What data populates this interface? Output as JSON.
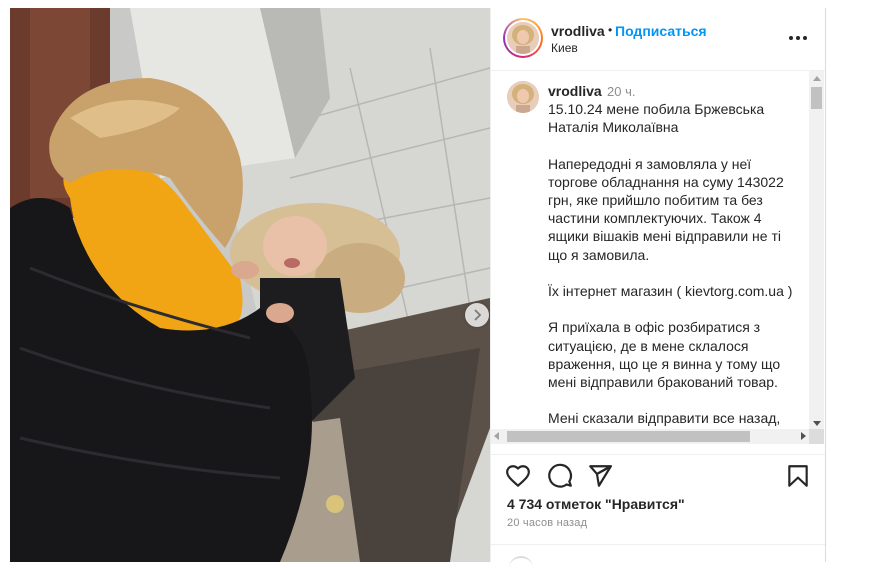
{
  "post": {
    "username": "vrodliva",
    "dot": "•",
    "follow_label": "Подписаться",
    "location": "Киев",
    "more_icon": "more-horizontal-icon",
    "next_icon": "chevron-right-icon"
  },
  "caption": {
    "username": "vrodliva",
    "time_ago": "20 ч.",
    "text": "15.10.24 мене побила Бржевська\nНаталія Миколаївна\n\nНапередодні я замовляла у неї\nторгове обладнання на суму 143022\nгрн, яке прийшло побитим та без\nчастини комплектуючих. Також 4\nящики вішаків мені відправили не ті\nщо я замовила.\n\nЇх інтернет магазин ( kievtorg.com.ua )\n\nЯ приїхала в офіс розбиратися з\nситуацією, де в мене склалося\nвраження, що це я винна у тому що\nмені відправили бракований товар.\n\nМені сказали відправити все назад,\nде гроші мені повернуть після того, як"
  },
  "actions": {
    "like_icon": "heart-icon",
    "comment_icon": "comment-icon",
    "share_icon": "paper-plane-icon",
    "save_icon": "bookmark-icon"
  },
  "likes_text": "4 734 отметок \"Нравится\"",
  "posted_ago": "20 часов назад",
  "colors": {
    "link_blue": "#0095f6",
    "text": "#262626",
    "muted": "#8e8e8e",
    "border": "#dbdbdb"
  }
}
